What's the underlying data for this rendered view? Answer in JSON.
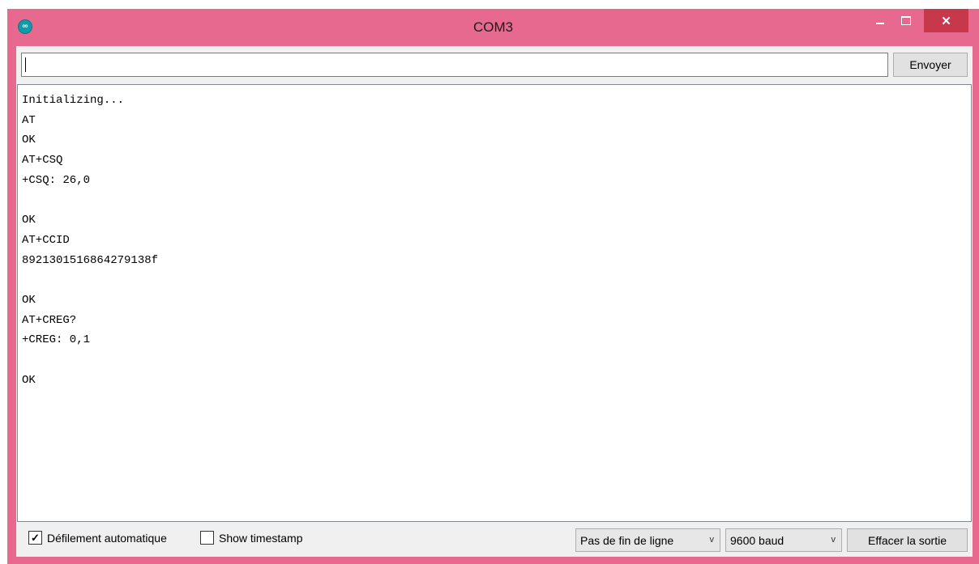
{
  "window": {
    "title": "COM3",
    "app_icon_glyph": "∞",
    "controls": {
      "close_glyph": "✕"
    }
  },
  "send": {
    "input_value": "",
    "button_label": "Envoyer"
  },
  "output": {
    "lines": [
      "Initializing...",
      "AT",
      "OK",
      "AT+CSQ",
      "+CSQ: 26,0",
      "",
      "OK",
      "AT+CCID",
      "8921301516864279138f",
      "",
      "OK",
      "AT+CREG?",
      "+CREG: 0,1",
      "",
      "OK"
    ]
  },
  "footer": {
    "autoscroll": {
      "label": "Défilement automatique",
      "checked": true,
      "check_glyph": "✓"
    },
    "timestamp": {
      "label": "Show timestamp",
      "checked": false
    },
    "line_ending": {
      "selected": "Pas de fin de ligne",
      "chevron": "v"
    },
    "baud": {
      "selected": "9600 baud",
      "chevron": "v"
    },
    "clear_label": "Effacer la sortie"
  },
  "colors": {
    "titlebar": "#e8698f",
    "close_button": "#c7384b",
    "app_icon": "#0e9aa7"
  }
}
